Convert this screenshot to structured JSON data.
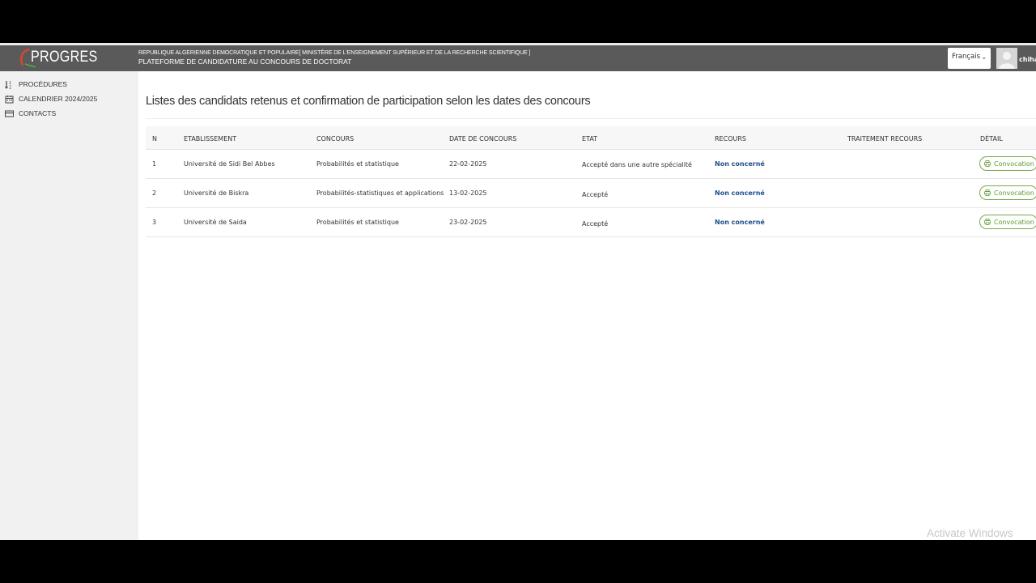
{
  "header": {
    "logo_text": "PROGRES",
    "line1": "REPUBLIQUE ALGERIENNE DEMOCRATIQUE ET POPULAIRE[ MINISTÈRE DE L'ENSEIGNEMENT SUPÉRIEUR ET DE LA RECHERCHE SCIENTIFIQUE ]",
    "line2": "PLATEFORME DE CANDIDATURE AU CONCOURS DE DOCTORAT",
    "language": "Français",
    "username": "chiha"
  },
  "sidebar": {
    "items": [
      {
        "label": "PROCÉDURES",
        "icon": "sort-icon"
      },
      {
        "label": "CALENDRIER 2024/2025",
        "icon": "calendar-icon"
      },
      {
        "label": "CONTACTS",
        "icon": "card-icon"
      }
    ]
  },
  "main": {
    "title": "Listes des candidats retenus et confirmation de participation selon les dates des concours",
    "columns": [
      "N",
      "ETABLISSEMENT",
      "CONCOURS",
      "DATE DE CONCOURS",
      "ETAT",
      "RECOURS",
      "TRAITEMENT RECOURS",
      "DÉTAIL"
    ],
    "rows": [
      {
        "n": "1",
        "etablissement": "Université de Sidi Bel Abbes",
        "concours": "Probabilités et statistique",
        "date": "22-02-2025",
        "etat": "Accepté dans une autre spécialité",
        "recours": "Non concerné",
        "traitement": "",
        "detail": "Convocation"
      },
      {
        "n": "2",
        "etablissement": "Université de Biskra",
        "concours": "Probabilités-statistiques et applications",
        "date": "13-02-2025",
        "etat": "Accepté",
        "recours": "Non concerné",
        "traitement": "",
        "detail": "Convocation"
      },
      {
        "n": "3",
        "etablissement": "Université de Saida",
        "concours": "Probabilités et statistique",
        "date": "23-02-2025",
        "etat": "Accepté",
        "recours": "Non concerné",
        "traitement": "",
        "detail": "Convocation"
      }
    ]
  },
  "watermark": "Activate Windows",
  "colors": {
    "header_bg": "#5a5a5a",
    "sidebar_bg": "#f1f1f1",
    "recours_link": "#1f4e8c",
    "convocation_green": "#5d9a2e"
  }
}
